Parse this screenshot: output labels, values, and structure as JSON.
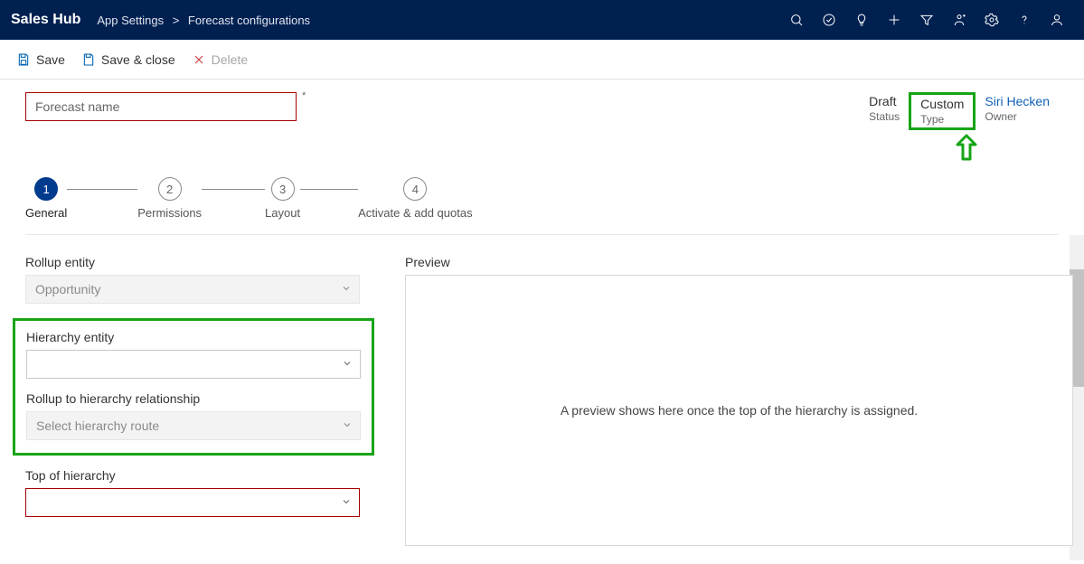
{
  "topbar": {
    "brand": "Sales Hub",
    "breadcrumb": {
      "parent": "App Settings",
      "current": "Forecast configurations"
    }
  },
  "commands": {
    "save": "Save",
    "save_close": "Save & close",
    "delete": "Delete"
  },
  "header": {
    "name_placeholder": "Forecast name",
    "meta": {
      "status": {
        "value": "Draft",
        "label": "Status"
      },
      "type": {
        "value": "Custom",
        "label": "Type"
      },
      "owner": {
        "value": "Siri Hecken",
        "label": "Owner"
      }
    }
  },
  "stepper": {
    "steps": [
      {
        "num": "1",
        "label": "General"
      },
      {
        "num": "2",
        "label": "Permissions"
      },
      {
        "num": "3",
        "label": "Layout"
      },
      {
        "num": "4",
        "label": "Activate & add quotas"
      }
    ],
    "active_index": 0
  },
  "form": {
    "rollup_entity": {
      "label": "Rollup entity",
      "value": "Opportunity"
    },
    "hierarchy_entity": {
      "label": "Hierarchy entity",
      "value": ""
    },
    "rollup_relationship": {
      "label": "Rollup to hierarchy relationship",
      "placeholder": "Select hierarchy route"
    },
    "top_of_hierarchy": {
      "label": "Top of hierarchy",
      "value": ""
    }
  },
  "preview": {
    "label": "Preview",
    "empty_text": "A preview shows here once the top of the hierarchy is assigned."
  },
  "colors": {
    "highlight_green": "#17a417",
    "error_red": "#a80000",
    "link_blue": "#1160b7",
    "navy": "#002050"
  }
}
